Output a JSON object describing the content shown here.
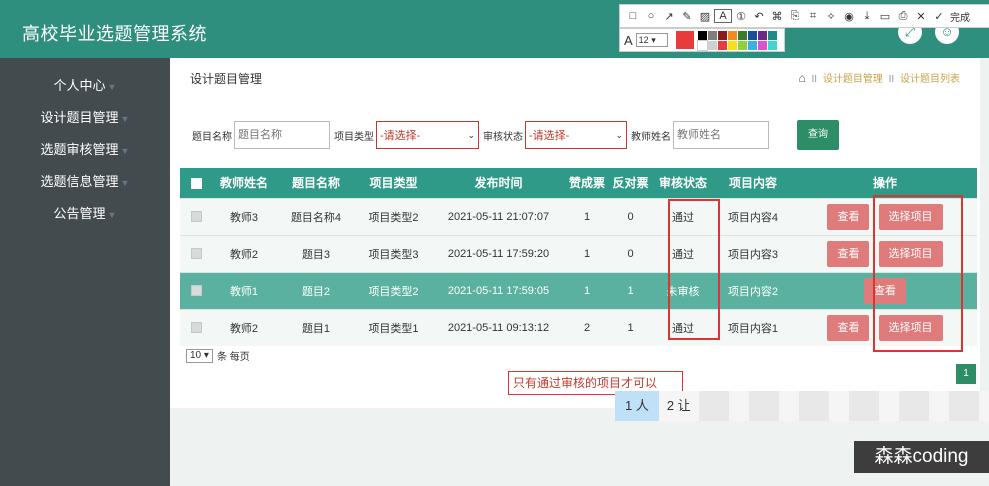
{
  "app": {
    "title": "高校毕业选题管理系统"
  },
  "header_icons": [
    {
      "icon": "fullscreen-icon",
      "glyph": "⤢"
    },
    {
      "icon": "user-icon",
      "glyph": "☺"
    }
  ],
  "sidebar": {
    "items": [
      {
        "label": "个人中心"
      },
      {
        "label": "设计题目管理"
      },
      {
        "label": "选题审核管理"
      },
      {
        "label": "选题信息管理"
      },
      {
        "label": "公告管理"
      }
    ]
  },
  "page": {
    "title": "设计题目管理",
    "breadcrumb": [
      "设计题目管理",
      "设计题目列表"
    ],
    "breadcrumb_sep": "II"
  },
  "filters": {
    "title_label": "题目名称",
    "title_placeholder": "题目名称",
    "type_label": "项目类型",
    "type_value": "-请选择-",
    "status_label": "审核状态",
    "status_value": "-请选择-",
    "teacher_label": "教师姓名",
    "teacher_placeholder": "教师姓名",
    "search_label": "查询"
  },
  "table": {
    "headers": [
      "教师姓名",
      "题目名称",
      "项目类型",
      "发布时间",
      "赞成票",
      "反对票",
      "审核状态",
      "项目内容",
      "操作"
    ],
    "rows": [
      {
        "teacher": "教师3",
        "title": "题目名称4",
        "type": "项目类型2",
        "time": "2021-05-11 21:07:07",
        "yes": "1",
        "no": "0",
        "status": "通过",
        "content": "项目内容4",
        "view": "查看",
        "select": "选择项目"
      },
      {
        "teacher": "教师2",
        "title": "题目3",
        "type": "项目类型3",
        "time": "2021-05-11 17:59:20",
        "yes": "1",
        "no": "0",
        "status": "通过",
        "content": "项目内容3",
        "view": "查看",
        "select": "选择项目"
      },
      {
        "teacher": "教师1",
        "title": "题目2",
        "type": "项目类型2",
        "time": "2021-05-11 17:59:05",
        "yes": "1",
        "no": "1",
        "status": "未审核",
        "content": "项目内容2",
        "view": "查看"
      },
      {
        "teacher": "教师2",
        "title": "题目1",
        "type": "项目类型1",
        "time": "2021-05-11 09:13:12",
        "yes": "2",
        "no": "1",
        "status": "通过",
        "content": "项目内容1",
        "view": "查看",
        "select": "选择项目"
      }
    ]
  },
  "pager": {
    "page_size": "10",
    "per_page_label": "条 每页",
    "current_page": "1"
  },
  "annotation": {
    "text": "只有通过审核的项目才可以"
  },
  "ime": {
    "cand1": "1 人",
    "cand2": "2 让"
  },
  "screenshot_tool": {
    "done_label": "完成",
    "font_size": "12",
    "current_color": "#e83b3b",
    "palette": [
      "#000000",
      "#7f7f7f",
      "#8b1a1a",
      "#f08c1c",
      "#3a7d2c",
      "#1a4f9c",
      "#6b2a84",
      "#1f8a8a",
      "#ffffff",
      "#d0d0d0",
      "#e83b3b",
      "#f6e21c",
      "#8ed13c",
      "#3bb0e8",
      "#e04fd0",
      "#3fd6d0"
    ]
  },
  "watermark": {
    "text": "森森coding"
  }
}
